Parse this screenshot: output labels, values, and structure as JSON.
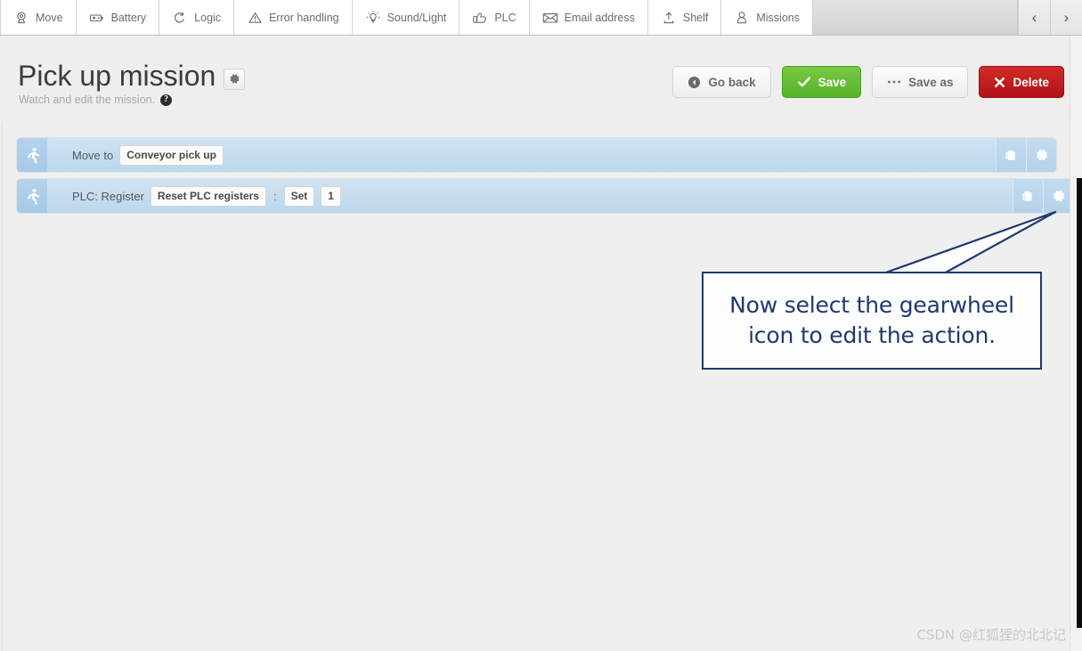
{
  "tabbar": {
    "tabs": [
      {
        "label": "Move",
        "icon": "map-pin-icon"
      },
      {
        "label": "Battery",
        "icon": "battery-icon"
      },
      {
        "label": "Logic",
        "icon": "loop-arrow-icon"
      },
      {
        "label": "Error handling",
        "icon": "warning-triangle-icon"
      },
      {
        "label": "Sound/Light",
        "icon": "lightbulb-icon"
      },
      {
        "label": "PLC",
        "icon": "thumbs-up-icon"
      },
      {
        "label": "Email address",
        "icon": "envelope-icon"
      },
      {
        "label": "Shelf",
        "icon": "upload-icon"
      },
      {
        "label": "Missions",
        "icon": "person-icon"
      }
    ],
    "prev_label": "‹",
    "next_label": "›"
  },
  "header": {
    "title": "Pick up mission",
    "title_gear_icon": "gear-icon",
    "subtitle": "Watch and edit the mission.",
    "help_label": "?",
    "buttons": [
      {
        "label": "Go back",
        "icon": "back-arrow-icon",
        "style": "grey"
      },
      {
        "label": "Save",
        "icon": "check-icon",
        "style": "green"
      },
      {
        "label": "Save as",
        "icon": "ellipsis-icon",
        "style": "grey"
      },
      {
        "label": "Delete",
        "icon": "cross-icon",
        "style": "red"
      }
    ]
  },
  "actions": {
    "row1": {
      "handle_icon": "running-person-icon",
      "label": "Move to",
      "value": "Conveyor pick up",
      "duplicate_icon": "duplicate-icon",
      "gear_icon": "gear-icon"
    },
    "row2": {
      "handle_icon": "running-person-icon",
      "label": "PLC: Register",
      "value": "Reset PLC registers",
      "separator": ":",
      "operation": "Set",
      "number": "1",
      "duplicate_icon": "duplicate-icon",
      "gear_icon": "gear-icon"
    }
  },
  "callout": {
    "line1": "Now select the gearwheel",
    "line2": "icon to edit the action.",
    "border_color": "#1f3a6e"
  },
  "watermark": {
    "text": "CSDN @红狐狸的北北记"
  },
  "colors": {
    "accent_green": "#5cb531",
    "accent_red": "#c0201f",
    "row_blue": "#c7ddef",
    "page_bg": "#eeeeee"
  }
}
